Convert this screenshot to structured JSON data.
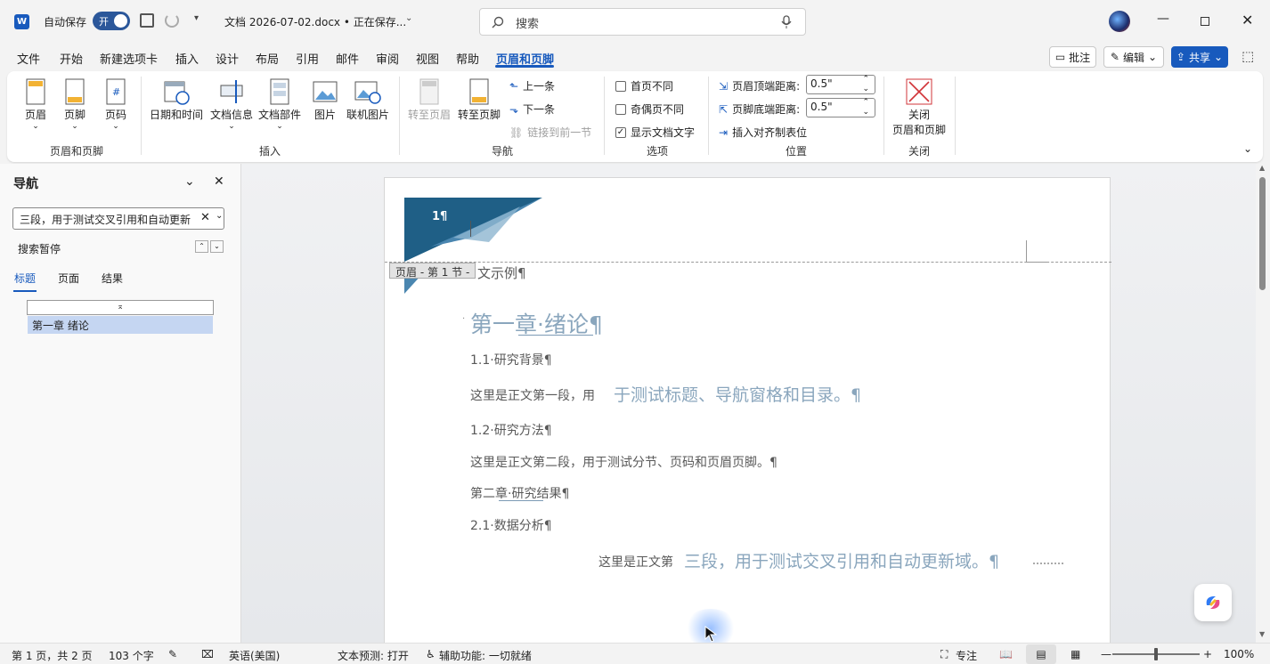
{
  "titlebar": {
    "autosave_label": "自动保存",
    "autosave_state": "开",
    "doc_title": "文档 2026-07-02.docx • 正在保存...",
    "search_placeholder": "搜索"
  },
  "tabs": [
    "文件",
    "开始",
    "新建选项卡",
    "插入",
    "设计",
    "布局",
    "引用",
    "邮件",
    "审阅",
    "视图",
    "帮助",
    "页眉和页脚"
  ],
  "active_tab": "页眉和页脚",
  "topright": {
    "comments": "批注",
    "editing": "编辑",
    "share": "共享"
  },
  "ribbon": {
    "hf": {
      "header": "页眉",
      "footer": "页脚",
      "pagenum": "页码",
      "group": "页眉和页脚"
    },
    "insert": {
      "datetime": "日期和时间",
      "docinfo": "文档信息",
      "quickparts": "文档部件",
      "picture": "图片",
      "onlinepic": "联机图片",
      "group": "插入"
    },
    "navigation": {
      "goto_header": "转至页眉",
      "goto_footer": "转至页脚",
      "prev": "上一条",
      "next": "下一条",
      "link_prev": "链接到前一节",
      "group": "导航"
    },
    "options": {
      "diff_first": "首页不同",
      "diff_oddeven": "奇偶页不同",
      "show_doc_text": "显示文档文字",
      "group": "选项"
    },
    "position": {
      "header_from_top": "页眉顶端距离:",
      "footer_from_bottom": "页脚底端距离:",
      "header_val": "0.5\"",
      "footer_val": "0.5\"",
      "insert_align_tab": "插入对齐制表位",
      "group": "位置"
    },
    "close": {
      "line1": "关闭",
      "line2": "页眉和页脚",
      "group": "关闭"
    }
  },
  "nav": {
    "title": "导航",
    "search_value": "三段，用于测试交叉引用和自动更新",
    "status": "搜索暂停",
    "tabs": [
      "标题",
      "页面",
      "结果"
    ],
    "heading": "第一章 绪论"
  },
  "doc": {
    "header_num": "1¶",
    "header_tag": "页眉 - 第 1 节 -",
    "subtitle": "文示例¶",
    "ch1": "第一章·绪论¶",
    "s11": "1.1·研究背景¶",
    "p1_a": "这里是正文第一段，用",
    "p1_b": "于测试标题、导航窗格和目录。¶",
    "s12": "1.2·研究方法¶",
    "p2": "这里是正文第二段，用于测试分节、页码和页眉页脚。¶",
    "ch2": "第二章·研究结果¶",
    "s21": "2.1·数据分析¶",
    "p3_a": "这里是正文第",
    "p3_b": "三段，用于测试交叉引用和自动更新域。¶"
  },
  "status": {
    "page": "第 1 页，共 2 页",
    "words": "103 个字",
    "lang": "英语(美国)",
    "predict": "文本预测: 打开",
    "access": "辅助功能: 一切就绪",
    "focus": "专注",
    "zoom": "100%"
  },
  "colors": {
    "accent": "#185abd",
    "word_blue": "#2b579a",
    "header_dark": "#1f5f86"
  }
}
